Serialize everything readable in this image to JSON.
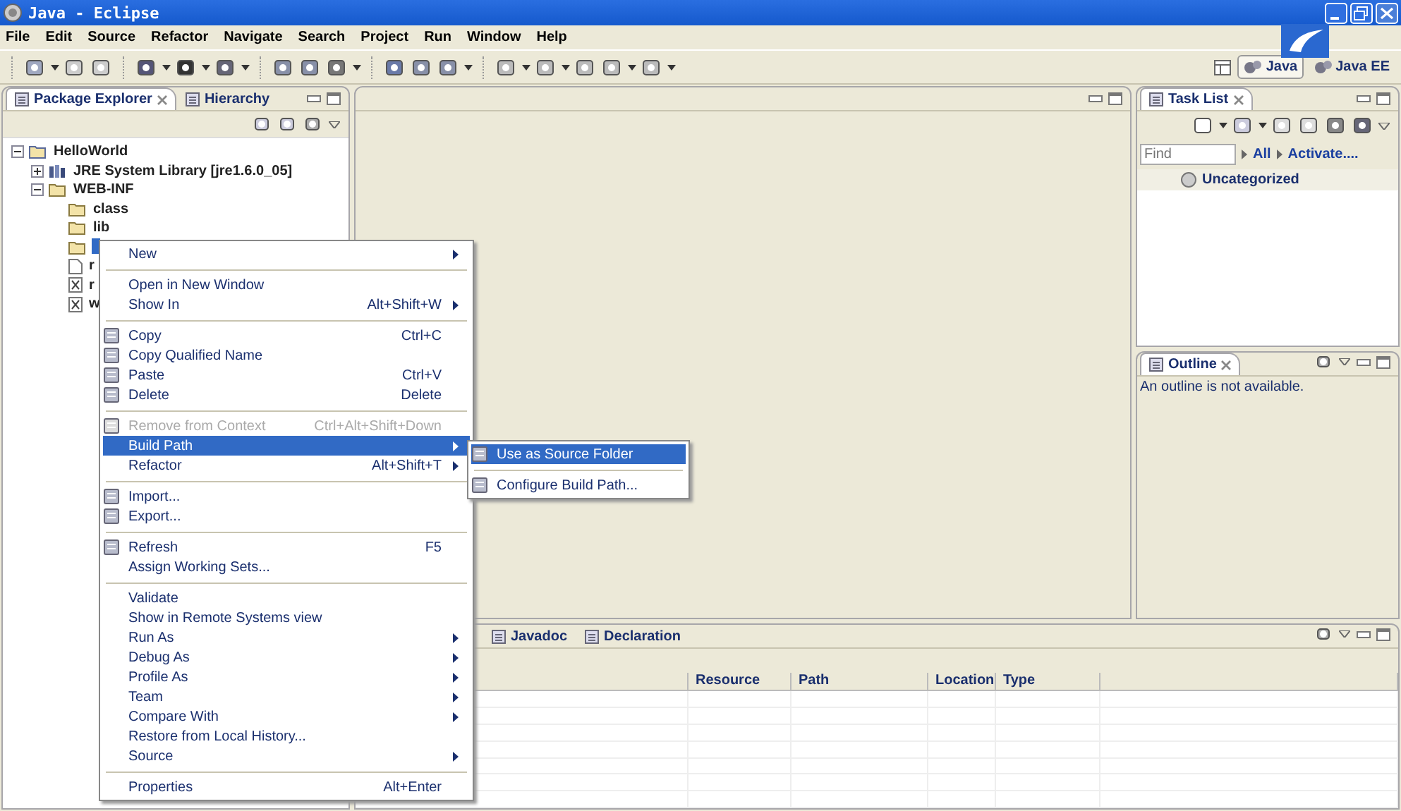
{
  "window": {
    "title": "Java - Eclipse"
  },
  "menu_bar": [
    "File",
    "Edit",
    "Source",
    "Refactor",
    "Navigate",
    "Search",
    "Project",
    "Run",
    "Window",
    "Help"
  ],
  "perspectives": [
    {
      "label": "Java",
      "selected": true
    },
    {
      "label": "Java EE",
      "selected": false
    }
  ],
  "package_explorer": {
    "tabs": [
      {
        "label": "Package Explorer",
        "selected": true
      },
      {
        "label": "Hierarchy",
        "selected": false
      }
    ],
    "tree": [
      {
        "label": "HelloWorld",
        "kind": "project",
        "expanded": true,
        "selected": false,
        "children": [
          {
            "label": "JRE System Library [jre1.6.0_05]",
            "kind": "library",
            "expanded": false,
            "selected": false
          },
          {
            "label": "WEB-INF",
            "kind": "folder",
            "expanded": true,
            "selected": false,
            "children": [
              {
                "label": "class",
                "kind": "folder",
                "selected": false
              },
              {
                "label": "lib",
                "kind": "folder",
                "selected": false
              },
              {
                "kind": "folder",
                "selected": true
              },
              {
                "label": "r",
                "kind": "file",
                "selected": false
              },
              {
                "label": "r",
                "kind": "xml",
                "selected": false
              },
              {
                "label": "w",
                "kind": "xml",
                "selected": false
              }
            ]
          }
        ]
      }
    ]
  },
  "task_list": {
    "tabs": [
      {
        "label": "Task List",
        "selected": true
      }
    ],
    "find": {
      "placeholder": "Find"
    },
    "links": [
      "All",
      "Activate...."
    ],
    "category": "Uncategorized"
  },
  "outline": {
    "tabs": [
      {
        "label": "Outline",
        "selected": true
      }
    ],
    "message": "An outline is not available."
  },
  "bottom_panel": {
    "tabs": [
      {
        "label": "Javadoc",
        "selected": false
      },
      {
        "label": "Declaration",
        "selected": false
      }
    ],
    "table": {
      "columns": [
        "Resource",
        "Path",
        "Location",
        "Type"
      ]
    }
  },
  "context_menu": {
    "items": [
      {
        "kind": "item",
        "label": "New",
        "submenu": true,
        "icon": false,
        "disabled": false,
        "selected": false
      },
      {
        "kind": "separator"
      },
      {
        "kind": "item",
        "label": "Open in New Window",
        "submenu": false,
        "icon": false,
        "disabled": false,
        "selected": false
      },
      {
        "kind": "item",
        "label": "Show In",
        "shortcut": "Alt+Shift+W",
        "submenu": true,
        "icon": false,
        "disabled": false,
        "selected": false
      },
      {
        "kind": "separator"
      },
      {
        "kind": "item",
        "label": "Copy",
        "shortcut": "Ctrl+C",
        "submenu": false,
        "icon": true,
        "disabled": false,
        "selected": false
      },
      {
        "kind": "item",
        "label": "Copy Qualified Name",
        "submenu": false,
        "icon": true,
        "disabled": false,
        "selected": false
      },
      {
        "kind": "item",
        "label": "Paste",
        "shortcut": "Ctrl+V",
        "submenu": false,
        "icon": true,
        "disabled": false,
        "selected": false
      },
      {
        "kind": "item",
        "label": "Delete",
        "shortcut": "Delete",
        "submenu": false,
        "icon": true,
        "disabled": false,
        "selected": false
      },
      {
        "kind": "separator"
      },
      {
        "kind": "item",
        "label": "Remove from Context",
        "shortcut": "Ctrl+Alt+Shift+Down",
        "submenu": false,
        "icon": true,
        "disabled": true,
        "selected": false
      },
      {
        "kind": "item",
        "label": "Build Path",
        "submenu": true,
        "icon": false,
        "disabled": false,
        "selected": true
      },
      {
        "kind": "item",
        "label": "Refactor",
        "shortcut": "Alt+Shift+T",
        "submenu": true,
        "icon": false,
        "disabled": false,
        "selected": false
      },
      {
        "kind": "separator"
      },
      {
        "kind": "item",
        "label": "Import...",
        "submenu": false,
        "icon": true,
        "disabled": false,
        "selected": false
      },
      {
        "kind": "item",
        "label": "Export...",
        "submenu": false,
        "icon": true,
        "disabled": false,
        "selected": false
      },
      {
        "kind": "separator"
      },
      {
        "kind": "item",
        "label": "Refresh",
        "shortcut": "F5",
        "submenu": false,
        "icon": true,
        "disabled": false,
        "selected": false
      },
      {
        "kind": "item",
        "label": "Assign Working Sets...",
        "submenu": false,
        "icon": false,
        "disabled": false,
        "selected": false
      },
      {
        "kind": "separator"
      },
      {
        "kind": "item",
        "label": "Validate",
        "submenu": false,
        "icon": false,
        "disabled": false,
        "selected": false
      },
      {
        "kind": "item",
        "label": "Show in Remote Systems view",
        "submenu": false,
        "icon": false,
        "disabled": false,
        "selected": false
      },
      {
        "kind": "item",
        "label": "Run As",
        "submenu": true,
        "icon": false,
        "disabled": false,
        "selected": false
      },
      {
        "kind": "item",
        "label": "Debug As",
        "submenu": true,
        "icon": false,
        "disabled": false,
        "selected": false
      },
      {
        "kind": "item",
        "label": "Profile As",
        "submenu": true,
        "icon": false,
        "disabled": false,
        "selected": false
      },
      {
        "kind": "item",
        "label": "Team",
        "submenu": true,
        "icon": false,
        "disabled": false,
        "selected": false
      },
      {
        "kind": "item",
        "label": "Compare With",
        "submenu": true,
        "icon": false,
        "disabled": false,
        "selected": false
      },
      {
        "kind": "item",
        "label": "Restore from Local History...",
        "submenu": false,
        "icon": false,
        "disabled": false,
        "selected": false
      },
      {
        "kind": "item",
        "label": "Source",
        "submenu": true,
        "icon": false,
        "disabled": false,
        "selected": false
      },
      {
        "kind": "separator"
      },
      {
        "kind": "item",
        "label": "Properties",
        "shortcut": "Alt+Enter",
        "submenu": false,
        "icon": false,
        "disabled": false,
        "selected": false
      }
    ]
  },
  "submenu": {
    "items": [
      {
        "kind": "item",
        "label": "Use as Source Folder",
        "icon": true,
        "selected": true
      },
      {
        "kind": "separator"
      },
      {
        "kind": "item",
        "label": "Configure Build Path...",
        "icon": true,
        "selected": false
      }
    ]
  }
}
